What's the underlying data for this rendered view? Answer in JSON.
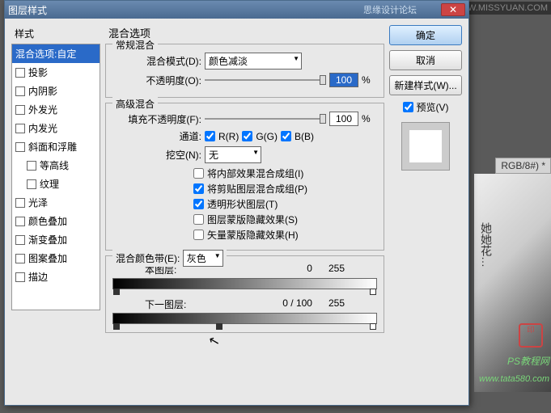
{
  "topbar_wm": "WWW.MISSYUAN.COM",
  "bg": {
    "tab": "RGB/8#) *",
    "wm1": "PS教程网",
    "wm2": "www.tata580.com",
    "ink": "她她花…"
  },
  "window": {
    "title": "图层样式",
    "subtitle": "思缘设计论坛",
    "styles_label": "样式",
    "styles": [
      {
        "label": "混合选项:自定",
        "selected": true,
        "checkbox": false
      },
      {
        "label": "投影",
        "checkbox": true,
        "checked": false
      },
      {
        "label": "内阴影",
        "checkbox": true,
        "checked": false
      },
      {
        "label": "外发光",
        "checkbox": true,
        "checked": false
      },
      {
        "label": "内发光",
        "checkbox": true,
        "checked": false
      },
      {
        "label": "斜面和浮雕",
        "checkbox": true,
        "checked": false
      },
      {
        "label": "等高线",
        "checkbox": true,
        "checked": false,
        "indent": true
      },
      {
        "label": "纹理",
        "checkbox": true,
        "checked": false,
        "indent": true
      },
      {
        "label": "光泽",
        "checkbox": true,
        "checked": false
      },
      {
        "label": "颜色叠加",
        "checkbox": true,
        "checked": false
      },
      {
        "label": "渐变叠加",
        "checkbox": true,
        "checked": false
      },
      {
        "label": "图案叠加",
        "checkbox": true,
        "checked": false
      },
      {
        "label": "描边",
        "checkbox": true,
        "checked": false
      }
    ],
    "blend_options": {
      "title": "混合选项",
      "general": {
        "title": "常规混合",
        "mode_label": "混合模式(D):",
        "mode_value": "颜色减淡",
        "opacity_label": "不透明度(O):",
        "opacity_value": "100",
        "pct": "%"
      },
      "advanced": {
        "title": "高级混合",
        "fill_label": "填充不透明度(F):",
        "fill_value": "100",
        "pct": "%",
        "channels_label": "通道:",
        "ch_r": "R(R)",
        "ch_g": "G(G)",
        "ch_b": "B(B)",
        "knockout_label": "挖空(N):",
        "knockout_value": "无",
        "opts": [
          {
            "label": "将内部效果混合成组(I)",
            "checked": false
          },
          {
            "label": "将剪贴图层混合成组(P)",
            "checked": true
          },
          {
            "label": "透明形状图层(T)",
            "checked": true
          },
          {
            "label": "图层蒙版隐藏效果(S)",
            "checked": false
          },
          {
            "label": "矢量蒙版隐藏效果(H)",
            "checked": false
          }
        ]
      },
      "blendif": {
        "title": "混合颜色带(E):",
        "value": "灰色",
        "this_label": "本图层:",
        "this_lo": "0",
        "this_hi": "255",
        "under_label": "下一图层:",
        "under_lo": "0",
        "under_mid": "100",
        "under_hi": "255"
      }
    },
    "buttons": {
      "ok": "确定",
      "cancel": "取消",
      "newstyle": "新建样式(W)...",
      "preview": "预览(V)"
    }
  }
}
